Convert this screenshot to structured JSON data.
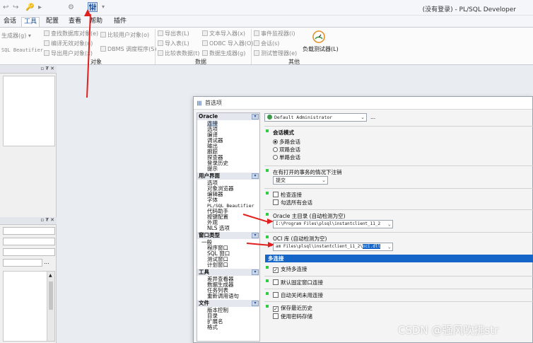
{
  "titlebar": {
    "app_title": "(没有登录) - PL/SQL Developer",
    "quick_icons": [
      "↩",
      "↪",
      "🔑",
      "▸",
      "⚙"
    ]
  },
  "tabs": [
    "会话",
    "工具",
    "配置",
    "查看",
    "帮助",
    "插件"
  ],
  "active_tab": "工具",
  "ribbon": {
    "col1": [
      "生成器(g)",
      "SQL Beautifier"
    ],
    "col2": [
      "查找数据库对象(e)",
      "编译无效对象(n)",
      "导出用户对象(x)"
    ],
    "col3": [
      "比较用户对象(o)",
      "DBMS 调度程序(S)"
    ],
    "col4": [
      "导出表(L)",
      "导入表(L)",
      "比较表数据(t)"
    ],
    "col5": [
      "文本导入器(x)",
      "ODBC 导入器(O)",
      "数据生成器(g)"
    ],
    "col6": [
      "事件监视器(i)",
      "会话(s)",
      "测试管理器(e)"
    ],
    "col7": [
      "负载测试器(L)"
    ],
    "groups": [
      "对象",
      "数据",
      "其他"
    ]
  },
  "dialog": {
    "title": "首选项",
    "profile": "Default Administrator",
    "profile_more": "...",
    "tree": {
      "cat_oracle": "Oracle",
      "oracle_items": [
        "连接",
        "选项",
        "编译",
        "调试器",
        "输出",
        "跟踪",
        "探查器",
        "登录历史",
        "提示"
      ],
      "cat_ui": "用户界面",
      "ui_items": [
        "选项",
        "对象浏览器",
        "编辑器",
        "字体",
        "PL/SQL Beautifier",
        "代码助手",
        "按键配置",
        "外观",
        "NLS 选项"
      ],
      "cat_wintype": "窗口类型",
      "wintype_items": [
        "一般",
        "程序窗口",
        "SQL 窗口",
        "测试窗口",
        "计划窗口"
      ],
      "cat_tools": "工具",
      "tools_items": [
        "差异查看器",
        "数据生成器",
        "任务列表",
        "重新调用语句"
      ],
      "cat_files": "文件",
      "files_items": [
        "版本控制",
        "目录",
        "扩展名",
        "格式"
      ]
    },
    "session_mode": {
      "title": "会话模式",
      "options": [
        "多路会话",
        "双路会话",
        "单路会话"
      ],
      "selected": "多路会话"
    },
    "open_tx": {
      "label": "在有打开的事务的情况下注销",
      "value": "提交"
    },
    "checks1": [
      {
        "label": "检查连接",
        "checked": false
      },
      {
        "label": "勾选所有会话",
        "checked": false
      }
    ],
    "oracle_home": {
      "label": "Oracle 主目录 (自动检测为空)",
      "value": "I:\\Program Files\\plsql\\instantclient_11_2"
    },
    "oci_lib": {
      "label": "OCI 库 (自动检测为空)",
      "value_prefix": "am Files\\plsql\\instantclient_11_2\\",
      "value_sel": "oci.dll"
    },
    "multi_conn": {
      "title": "多连接",
      "items": [
        {
          "label": "支持多连接",
          "checked": true
        },
        {
          "label": "默认固定窗口连接",
          "checked": false
        },
        {
          "label": "自动关闭未用连接",
          "checked": false
        },
        {
          "label": "保存最近历史",
          "checked": true
        },
        {
          "label": "使用密码存储",
          "checked": false
        }
      ]
    }
  },
  "left_panel": {
    "pin_label": "▫ ₮ ✕",
    "pin_label2": "▫ ₮ ✕",
    "btn_dots": "...",
    "btn_up": "▲"
  },
  "watermark": "CSDN @强风吹拂str"
}
